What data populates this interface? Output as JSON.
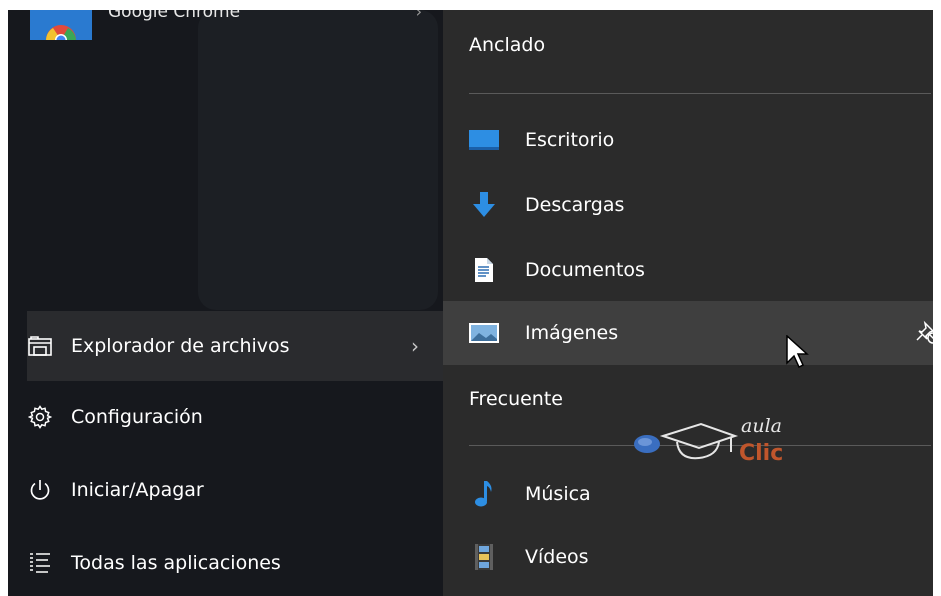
{
  "left_panel": {
    "top_app": {
      "label": "Google Chrome",
      "chevron": "›"
    },
    "items": [
      {
        "label": "Explorador de archivos",
        "icon": "file-explorer-icon",
        "chevron": "›",
        "active": true
      },
      {
        "label": "Configuración",
        "icon": "gear-icon"
      },
      {
        "label": "Iniciar/Apagar",
        "icon": "power-icon"
      },
      {
        "label": "Todas las aplicaciones",
        "icon": "all-apps-list-icon"
      }
    ]
  },
  "right_panel": {
    "pinned_heading": "Anclado",
    "pinned": [
      {
        "label": "Escritorio",
        "icon": "desktop-icon"
      },
      {
        "label": "Descargas",
        "icon": "download-arrow-icon"
      },
      {
        "label": "Documentos",
        "icon": "document-icon"
      },
      {
        "label": "Imágenes",
        "icon": "pictures-icon",
        "hovered": true
      }
    ],
    "frequent_heading": "Frecuente",
    "frequent": [
      {
        "label": "Música",
        "icon": "music-note-icon"
      },
      {
        "label": "Vídeos",
        "icon": "video-film-icon"
      }
    ]
  },
  "watermark": {
    "top": "aula",
    "bottom": "Clic"
  },
  "colors": {
    "left_bg": "#16181d",
    "right_bg": "#2b2b2b",
    "hover_bg": "#3f3f3f",
    "accent_blue": "#2d8ee3"
  }
}
